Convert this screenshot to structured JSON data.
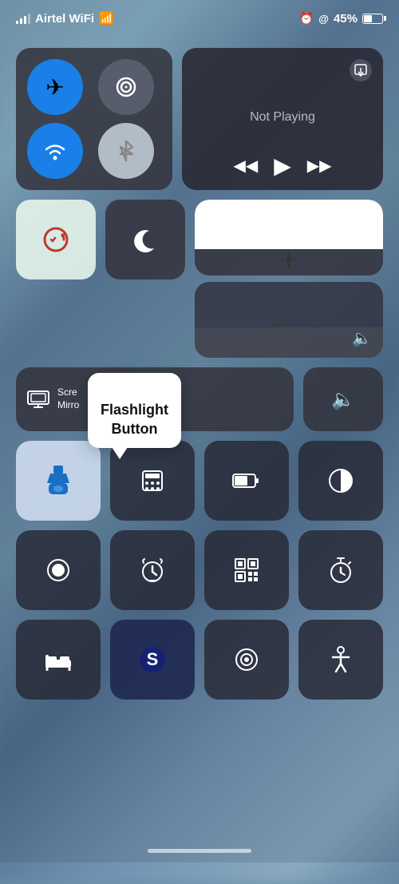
{
  "status": {
    "carrier": "Airtel WiFi",
    "battery_pct": "45%",
    "alarm_icon": "⏰",
    "location_icon": "@"
  },
  "connectivity": {
    "airplane_label": "✈",
    "cellular_label": "((·))",
    "wifi_label": "WiFi",
    "bluetooth_label": "Bluetooth"
  },
  "media": {
    "airplay_label": "AirPlay",
    "now_playing": "Not Playing",
    "prev": "◀◀",
    "play": "▶",
    "next": "▶▶"
  },
  "controls": {
    "screen_lock_label": "Screen Lock",
    "do_not_disturb_label": "Do Not Disturb",
    "screen_mirror_label": "Screen\nMirror",
    "volume_label": "Volume"
  },
  "tooltip": {
    "text": "Flashlight\nButton"
  },
  "icons_row1": [
    {
      "id": "flashlight",
      "icon": "🔦",
      "active": true
    },
    {
      "id": "calculator",
      "icon": "⌨"
    },
    {
      "id": "battery",
      "icon": "🔋"
    },
    {
      "id": "grayscale",
      "icon": "◑"
    }
  ],
  "icons_row2": [
    {
      "id": "record",
      "icon": "⊙"
    },
    {
      "id": "alarm",
      "icon": "⏰"
    },
    {
      "id": "qr",
      "icon": "▦"
    },
    {
      "id": "timer",
      "icon": "⏱"
    }
  ],
  "icons_row3": [
    {
      "id": "sleep",
      "icon": "🛏"
    },
    {
      "id": "shazam",
      "icon": "S"
    },
    {
      "id": "shazam2",
      "icon": "◎"
    },
    {
      "id": "accessibility",
      "icon": "♿"
    }
  ],
  "home_indicator": "home"
}
